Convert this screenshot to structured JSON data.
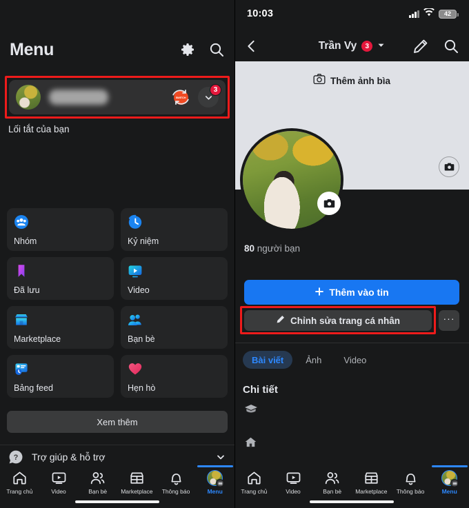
{
  "left_panel": {
    "title": "Menu",
    "header_icons": [
      {
        "name": "gear-icon",
        "label": "Cài đặt"
      },
      {
        "name": "search-icon",
        "label": "Tìm kiếm"
      }
    ],
    "profile_row": {
      "name_value": "",
      "avatar_switch_label": "SWITCH",
      "notification_count": "3",
      "highlighted": true
    },
    "shortcuts_label": "Lối tắt của bạn",
    "menu_items": [
      {
        "label": "Nhóm",
        "icon": "groups-icon"
      },
      {
        "label": "Kỷ niệm",
        "icon": "memories-clock-icon"
      },
      {
        "label": "Đã lưu",
        "icon": "saved-bookmark-icon"
      },
      {
        "label": "Video",
        "icon": "video-icon"
      },
      {
        "label": "Marketplace",
        "icon": "marketplace-store-icon"
      },
      {
        "label": "Bạn bè",
        "icon": "friends-icon"
      },
      {
        "label": "Bảng feed",
        "icon": "feeds-icon"
      },
      {
        "label": "Hẹn hò",
        "icon": "dating-heart-icon"
      }
    ],
    "see_more_label": "Xem thêm",
    "help_label": "Trợ giúp & hỗ trợ"
  },
  "right_panel": {
    "status_bar": {
      "time": "10:03",
      "battery_level": "42"
    },
    "header": {
      "title": "Trần Vy",
      "badge_count": "3",
      "back_icon": "back-chevron-icon",
      "edit_icon": "pencil-icon",
      "search_icon": "search-icon"
    },
    "cover": {
      "add_cover_label": "Thêm ảnh bìa",
      "camera_icon": "camera-icon"
    },
    "friends_count_number": "80",
    "friends_count_label": " người bạn",
    "add_story_label": "Thêm vào tin",
    "edit_profile_label": "Chỉnh sửa trang cá nhân",
    "more_label": "···",
    "edit_profile_highlighted": true,
    "tabs": [
      {
        "label": "Bài viết",
        "active": true
      },
      {
        "label": "Ảnh",
        "active": false
      },
      {
        "label": "Video",
        "active": false
      }
    ],
    "details_title": "Chi tiết",
    "detail_rows": [
      {
        "icon": "graduation-cap-icon",
        "text": ""
      },
      {
        "icon": "home-icon",
        "text": ""
      }
    ]
  },
  "bottom_nav": {
    "items": [
      {
        "label": "Trang chủ",
        "icon": "home-icon",
        "active": false
      },
      {
        "label": "Video",
        "icon": "video-icon",
        "active": false
      },
      {
        "label": "Bạn bè",
        "icon": "friends-icon",
        "active": false
      },
      {
        "label": "Marketplace",
        "icon": "marketplace-icon",
        "active": false
      },
      {
        "label": "Thông báo",
        "icon": "bell-icon",
        "active": false
      },
      {
        "label": "Menu",
        "icon": "avatar-menu-icon",
        "active": true
      }
    ]
  },
  "colors": {
    "accent_blue": "#1877f2",
    "active_blue": "#2d88ff",
    "highlight_red": "#ee1b1b",
    "badge_red": "#e4183c",
    "panel_bg": "#18191a",
    "card_bg": "#242526",
    "cover_bg": "#dfe1e6"
  }
}
